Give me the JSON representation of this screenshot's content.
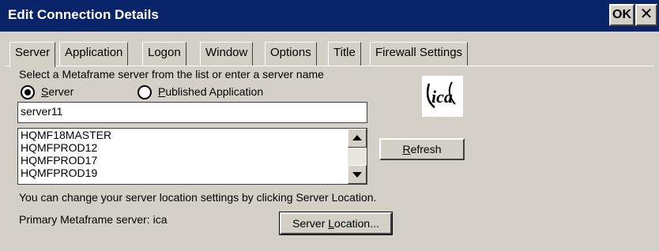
{
  "window": {
    "title": "Edit Connection Details",
    "ok_label": "OK",
    "close_label": "✕"
  },
  "tabs": [
    {
      "label": "Server",
      "active": true
    },
    {
      "label": "Application"
    },
    {
      "label": "Logon"
    },
    {
      "label": "Window"
    },
    {
      "label": "Options"
    },
    {
      "label": "Title"
    },
    {
      "label": "Firewall Settings"
    }
  ],
  "server_tab": {
    "instruction": "Select a Metaframe server from the list or enter a server name",
    "radio_server": {
      "label_prefix": "",
      "label_mnemonic": "S",
      "label_rest": "erver",
      "checked": true
    },
    "radio_published": {
      "label_mnemonic": "P",
      "label_rest": "ublished Application",
      "checked": false
    },
    "server_name_value": "server11",
    "server_list": [
      "HQMF18MASTER",
      "HQMFPROD12",
      "HQMFPROD17",
      "HQMFPROD19"
    ],
    "refresh": {
      "mnemonic": "R",
      "rest": "efresh"
    },
    "location_hint": "You can change your server location settings by clicking Server Location.",
    "primary_server_label": "Primary Metaframe server: ica",
    "server_location": {
      "prefix": "Server ",
      "mnemonic": "L",
      "rest": "ocation..."
    },
    "logo_text": "ica",
    "logo_icon": "ica-logo-icon"
  },
  "colors": {
    "titlebar": "#0a246a",
    "face": "#d4d0c8"
  }
}
